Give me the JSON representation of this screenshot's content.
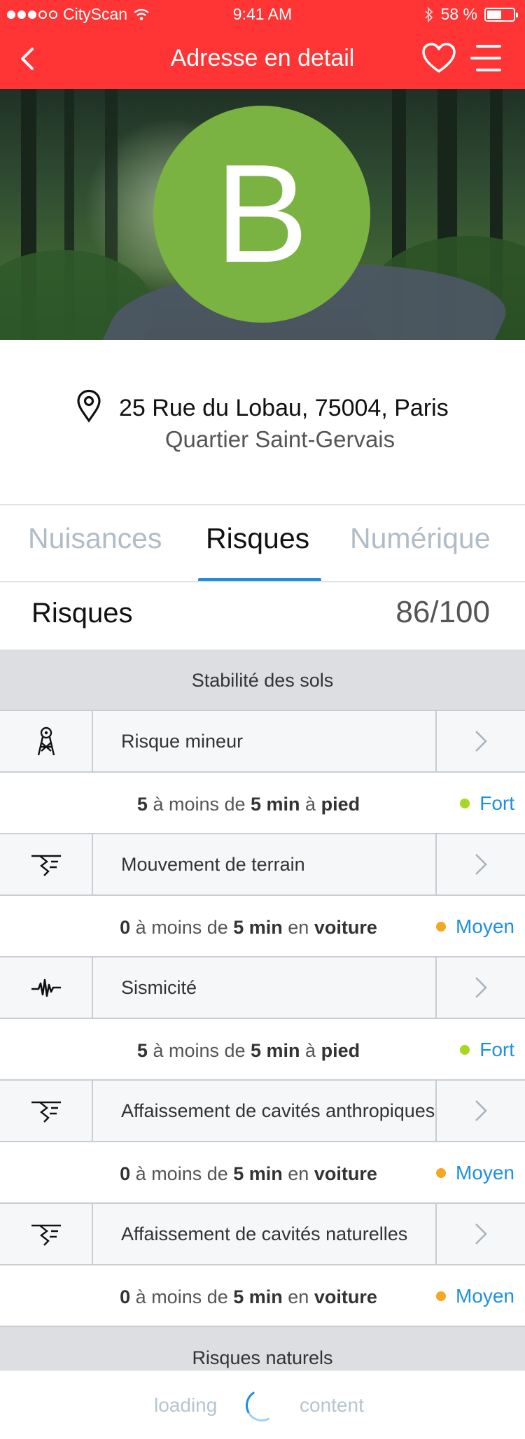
{
  "status": {
    "carrier": "CityScan",
    "time": "9:41 AM",
    "battery": "58 %"
  },
  "nav": {
    "title": "Adresse en detail"
  },
  "hero": {
    "grade": "B",
    "grade_color": "#7ab341"
  },
  "address": {
    "street": "25 Rue du Lobau, 75004, Paris",
    "district": "Quartier Saint-Gervais"
  },
  "tabs": [
    {
      "label": "Nuisances"
    },
    {
      "label": "Risques"
    },
    {
      "label": "Numérique"
    }
  ],
  "section": {
    "title": "Risques",
    "score": "86/100"
  },
  "categories": {
    "soil": "Stabilité des sols",
    "natural": "Risques naturels"
  },
  "items": [
    {
      "label": "Risque mineur",
      "icon": "mine-tower-icon",
      "count": "5",
      "mid1": " à moins de ",
      "dist": "5 min",
      "mid2": " à ",
      "mode": "pied",
      "level": "Fort",
      "level_color": "#a6d81f"
    },
    {
      "label": "Mouvement de terrain",
      "icon": "ground-crack-icon",
      "count": "0",
      "mid1": " à moins de ",
      "dist": "5 min",
      "mid2": " en ",
      "mode": "voiture",
      "level": "Moyen",
      "level_color": "#f5a623"
    },
    {
      "label": "Sismicité",
      "icon": "seismic-wave-icon",
      "count": "5",
      "mid1": " à moins de ",
      "dist": "5 min",
      "mid2": " à ",
      "mode": "pied",
      "level": "Fort",
      "level_color": "#a6d81f"
    },
    {
      "label": "Affaissement de cavités anthropiques",
      "icon": "ground-crack-icon",
      "count": "0",
      "mid1": " à moins de ",
      "dist": "5 min",
      "mid2": " en ",
      "mode": "voiture",
      "level": "Moyen",
      "level_color": "#f5a623"
    },
    {
      "label": "Affaissement de cavités naturelles",
      "icon": "ground-crack-icon",
      "count": "0",
      "mid1": " à moins de ",
      "dist": "5 min",
      "mid2": " en ",
      "mode": "voiture",
      "level": "Moyen",
      "level_color": "#f5a623"
    }
  ],
  "loading": {
    "left": "loading",
    "right": "content"
  },
  "colors": {
    "brand": "#ff3434",
    "accent": "#1f8fe0"
  }
}
